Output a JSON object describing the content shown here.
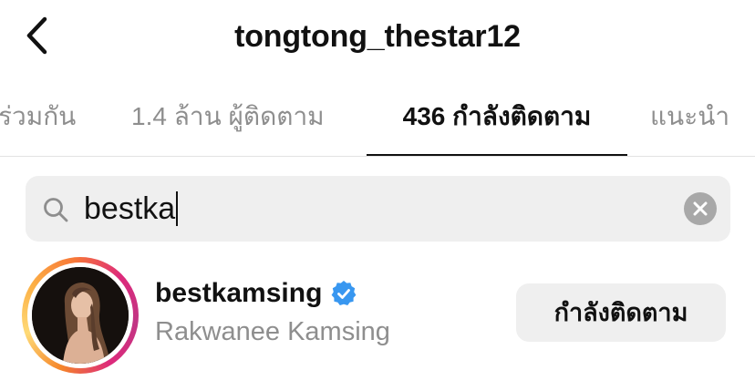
{
  "header": {
    "title": "tongtong_thestar12",
    "back_icon": "chevron-left-icon"
  },
  "tabs": [
    {
      "label": "ร่วมกัน",
      "active": false
    },
    {
      "label": "1.4 ล้าน ผู้ติดตาม",
      "active": false
    },
    {
      "label": "436 กำลังติดตาม",
      "active": true
    },
    {
      "label": "แนะนำ",
      "active": false
    }
  ],
  "search": {
    "value": "bestka",
    "icon": "search-icon",
    "clear_icon": "clear-icon"
  },
  "results": [
    {
      "username": "bestkamsing",
      "verified": true,
      "full_name": "Rakwanee Kamsing",
      "follow_status": "กำลังติดตาม",
      "has_story": true
    }
  ],
  "colors": {
    "verified_blue": "#3897f0",
    "muted_text": "#8e8e8e",
    "button_bg": "#efefef"
  }
}
